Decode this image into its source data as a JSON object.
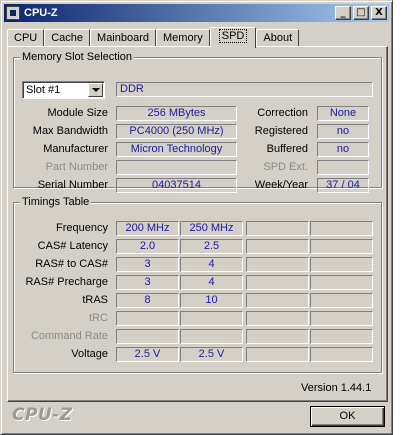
{
  "window": {
    "title": "CPU-Z"
  },
  "caption_buttons": {
    "minimize": "_",
    "maximize": "□",
    "close": "X"
  },
  "tabs": [
    {
      "label": "CPU"
    },
    {
      "label": "Cache"
    },
    {
      "label": "Mainboard"
    },
    {
      "label": "Memory"
    },
    {
      "label": "SPD",
      "active": true
    },
    {
      "label": "About"
    }
  ],
  "memory_slot": {
    "group_label": "Memory Slot Selection",
    "slot_select": "Slot #1",
    "type": "DDR",
    "module_size_label": "Module Size",
    "module_size": "256 MBytes",
    "max_bandwidth_label": "Max Bandwidth",
    "max_bandwidth": "PC4000 (250 MHz)",
    "manufacturer_label": "Manufacturer",
    "manufacturer": "Micron Technology",
    "part_number_label": "Part Number",
    "part_number": "",
    "serial_number_label": "Serial Number",
    "serial_number": "04037514",
    "correction_label": "Correction",
    "correction": "None",
    "registered_label": "Registered",
    "registered": "no",
    "buffered_label": "Buffered",
    "buffered": "no",
    "spd_ext_label": "SPD Ext.",
    "spd_ext": "",
    "week_year_label": "Week/Year",
    "week_year": "37 / 04"
  },
  "timings": {
    "group_label": "Timings Table",
    "rows": [
      {
        "label": "Frequency",
        "values": [
          "200 MHz",
          "250 MHz",
          "",
          ""
        ]
      },
      {
        "label": "CAS# Latency",
        "values": [
          "2.0",
          "2.5",
          "",
          ""
        ]
      },
      {
        "label": "RAS# to CAS#",
        "values": [
          "3",
          "4",
          "",
          ""
        ]
      },
      {
        "label": "RAS# Precharge",
        "values": [
          "3",
          "4",
          "",
          ""
        ]
      },
      {
        "label": "tRAS",
        "values": [
          "8",
          "10",
          "",
          ""
        ]
      },
      {
        "label": "tRC",
        "values": [
          "",
          "",
          "",
          ""
        ]
      },
      {
        "label": "Command Rate",
        "values": [
          "",
          "",
          "",
          ""
        ]
      },
      {
        "label": "Voltage",
        "values": [
          "2.5 V",
          "2.5 V",
          "",
          ""
        ]
      }
    ]
  },
  "footer": {
    "version": "Version 1.44.1",
    "logo": "CPU-Z",
    "ok_label": "OK"
  }
}
